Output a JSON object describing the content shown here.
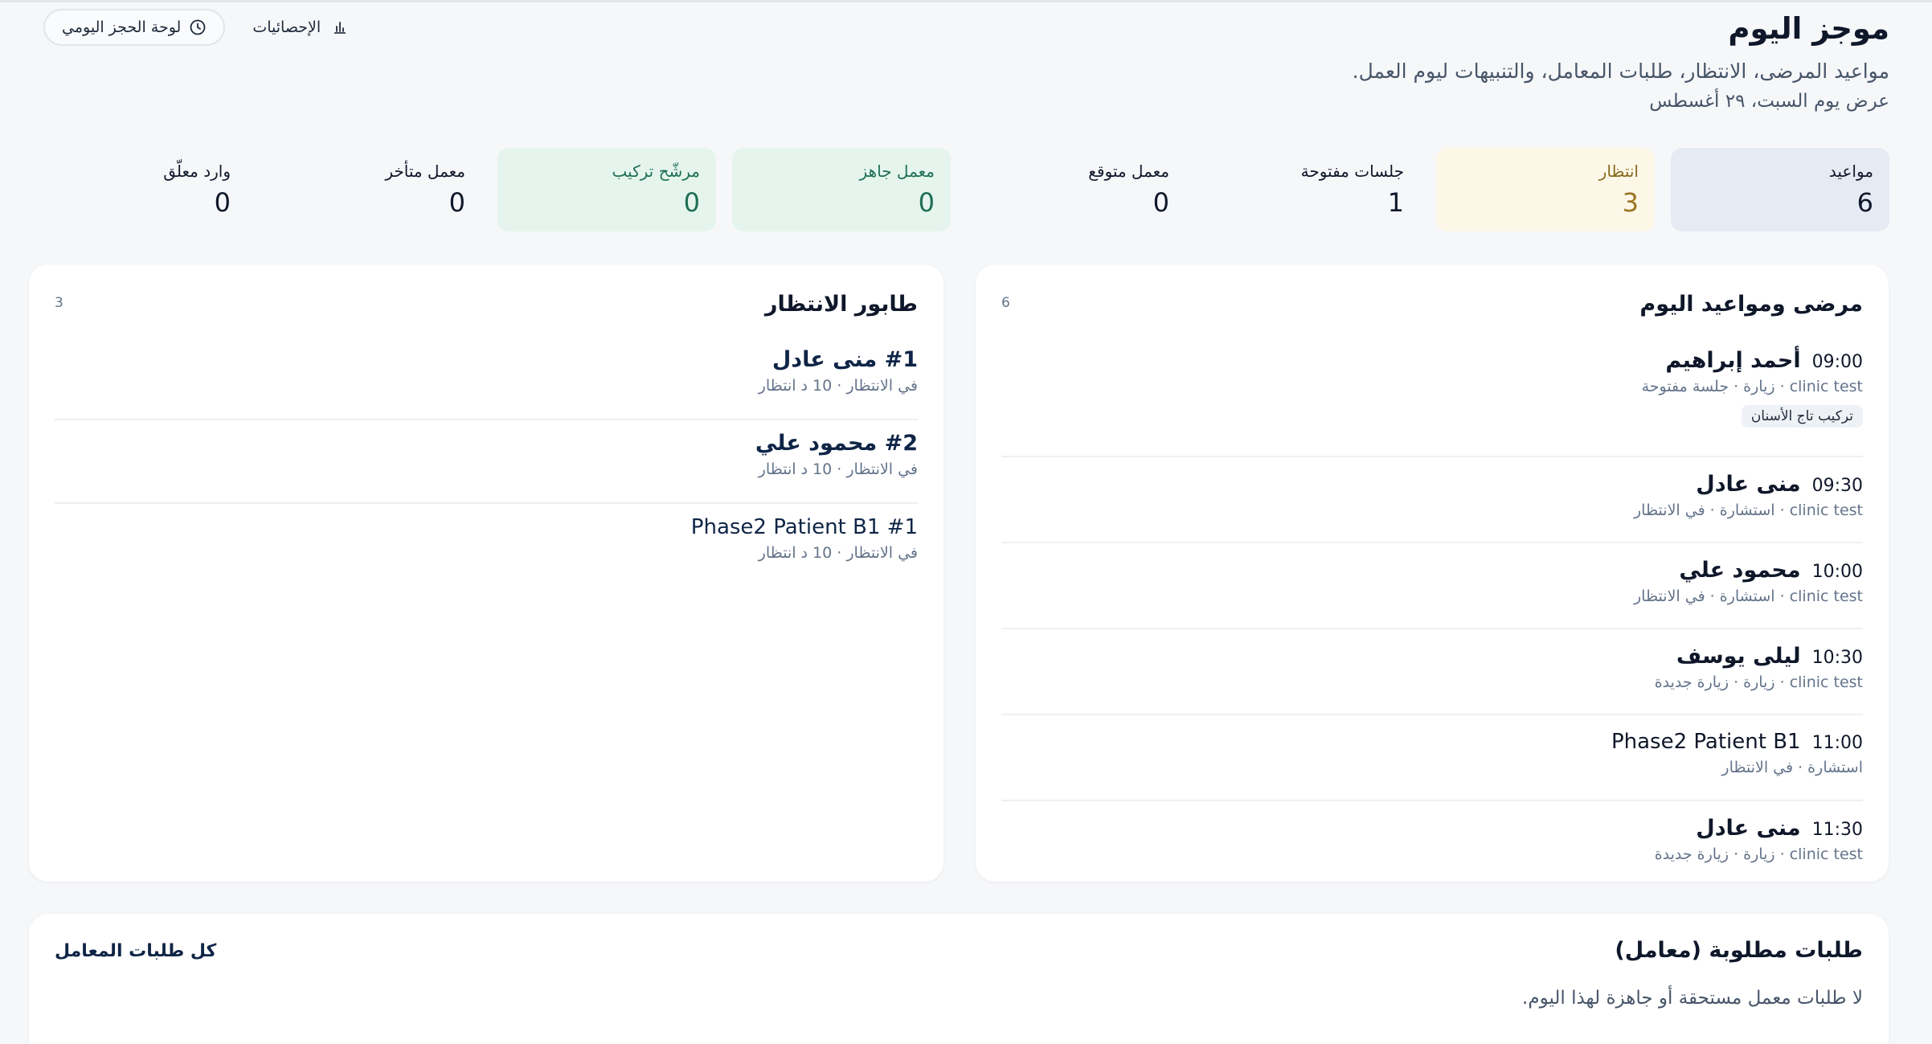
{
  "header": {
    "title": "موجز اليوم",
    "subtitle": "مواعيد المرضى، الانتظار، طلبات المعامل، والتنبيهات ليوم العمل.",
    "date_line": "عرض يوم السبت، ٢٩ أغسطس",
    "buttons": {
      "daily_board": {
        "label": "لوحة الحجز اليومي",
        "icon": "clock-icon"
      },
      "statistics": {
        "label": "الإحصائيات",
        "icon": "bar-chart-icon"
      }
    }
  },
  "stats": [
    {
      "label": "مواعيد",
      "value": "6",
      "tone": "slate"
    },
    {
      "label": "انتظار",
      "value": "3",
      "tone": "amber"
    },
    {
      "label": "جلسات مفتوحة",
      "value": "1",
      "tone": "plain"
    },
    {
      "label": "معمل متوقع",
      "value": "0",
      "tone": "plain"
    },
    {
      "label": "معمل جاهز",
      "value": "0",
      "tone": "green"
    },
    {
      "label": "مرشّح تركيب",
      "value": "0",
      "tone": "green"
    },
    {
      "label": "معمل متأخر",
      "value": "0",
      "tone": "plain"
    },
    {
      "label": "وارد معلّق",
      "value": "0",
      "tone": "plain"
    }
  ],
  "appointments": {
    "title": "مرضى ومواعيد اليوم",
    "count": "6",
    "items": [
      {
        "time": "09:00",
        "name": "أحمد إبراهيم",
        "meta": "clinic test · زيارة · جلسة مفتوحة",
        "tag": "تركيب تاج الأسنان"
      },
      {
        "time": "09:30",
        "name": "منى عادل",
        "meta": "clinic test · استشارة · في الانتظار"
      },
      {
        "time": "10:00",
        "name": "محمود علي",
        "meta": "clinic test · استشارة · في الانتظار"
      },
      {
        "time": "10:30",
        "name": "ليلى يوسف",
        "meta": "clinic test · زيارة · زيارة جديدة"
      },
      {
        "time": "11:00",
        "name": "Phase2 Patient B1",
        "meta": "استشارة · في الانتظار"
      },
      {
        "time": "11:30",
        "name": "منى عادل",
        "meta": "clinic test · زيارة · زيارة جديدة"
      }
    ]
  },
  "queue": {
    "title": "طابور الانتظار",
    "count": "3",
    "items": [
      {
        "name": "#1 منى عادل",
        "meta": "في الانتظار · 10 د انتظار"
      },
      {
        "name": "#2 محمود علي",
        "meta": "في الانتظار · 10 د انتظار"
      },
      {
        "name": "Phase2 Patient B1 #1",
        "meta": "في الانتظار · 10 د انتظار"
      }
    ]
  },
  "lab_requests": {
    "title": "طلبات مطلوبة (معامل)",
    "link": "كل طلبات المعامل",
    "empty": "لا طلبات معمل مستحقة أو جاهزة لهذا اليوم."
  }
}
